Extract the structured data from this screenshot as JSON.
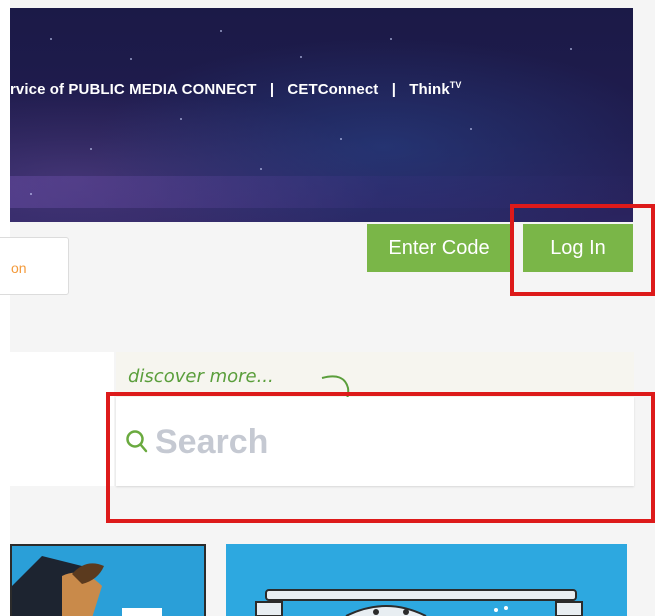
{
  "banner": {
    "link_text_main": "rvice of PUBLIC MEDIA CONNECT",
    "separator": "|",
    "link_cetconnect": "CETConnect",
    "link_think": "Think",
    "link_think_sup": "TV"
  },
  "left_button": {
    "label": "on"
  },
  "auth": {
    "enter_code_label": "Enter Code",
    "login_label": "Log In"
  },
  "search": {
    "discover_text": "discover more...",
    "placeholder": "Search"
  },
  "colors": {
    "accent_green": "#7ab648",
    "orange_text": "#f39a3b",
    "annotation_red": "#dd1a1a",
    "banner_dark": "#1b1a47"
  },
  "icons": {
    "search": "search-icon",
    "discover_arrow": "curved-arrow-icon"
  }
}
